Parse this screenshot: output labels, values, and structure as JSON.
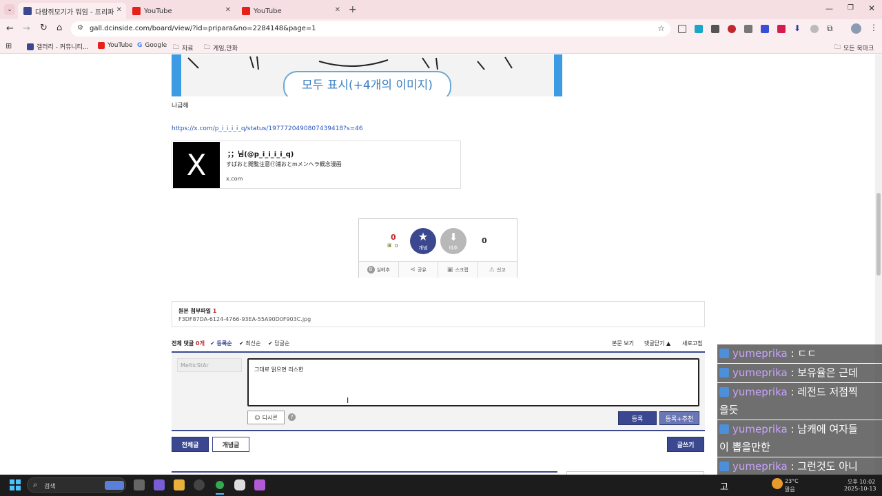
{
  "browser": {
    "tabs": [
      {
        "title": "다람쥐모기가 뭐임 - 프리파라",
        "active": true
      },
      {
        "title": "YouTube",
        "active": false
      },
      {
        "title": "YouTube",
        "active": false
      }
    ],
    "url": "gall.dcinside.com/board/view/?id=pripara&no=2284148&page=1",
    "bookmarks": [
      "갤러리 - 커뮤니티...",
      "YouTube",
      "Google",
      "자료",
      "게임,만화"
    ],
    "bookmarks_right": "모든 북마크"
  },
  "post": {
    "image_button": "모두 표시(+4개의 이미지)",
    "text_line": "나급해",
    "link": "https://x.com/p_i_i_i_i_q/status/1977720490807439418?s=46",
    "embed": {
      "name": "；；님(@p_i_i_i_i_q)",
      "desc": "すばおと閲覧注意⑰浦おとmメンヘラ概念漫画",
      "domain": "x.com"
    }
  },
  "vote": {
    "up_count": "0",
    "fixed_count": "0",
    "up_label": "개념",
    "down_label": "비추",
    "down_count": "0",
    "actions": [
      "실베추",
      "공유",
      "스크랩",
      "신고"
    ]
  },
  "attach": {
    "title": "원본 첨부파일",
    "count": "1",
    "file": "F3DF87DA-6124-4766-93EA-55A90D0F903C.jpg"
  },
  "comments": {
    "total_label": "전체 댓글",
    "total_count": "0개",
    "sort": [
      "등록순",
      "최신순",
      "답글순"
    ],
    "right_links": [
      "본문 보기",
      "댓글닫기 ▲",
      "새로고침"
    ],
    "nickname": "MelticStAr",
    "draft": "그대로 읽으면 리스한",
    "dccon": "디시콘",
    "submit": "등록",
    "submit_recommend": "등록+추천"
  },
  "board_buttons": {
    "all": "전체글",
    "concept": "개념글",
    "write": "글쓰기"
  },
  "chat": [
    {
      "name": "yumeprika",
      "msg": " : ㄷㄷ"
    },
    {
      "name": "yumeprika",
      "msg": " : 보유율은 근데"
    },
    {
      "name": "yumeprika",
      "msg": " : 레전드 저점찍",
      "cont": "을듯"
    },
    {
      "name": "yumeprika",
      "msg": " : 남캐에 여자들",
      "cont": "이 뽑을만한"
    },
    {
      "name": "yumeprika",
      "msg": " : 그런것도 아니"
    }
  ],
  "taskbar": {
    "search": "검색",
    "ime": "고",
    "weather_temp": "23°C",
    "weather_desc": "맑음",
    "time": "오후 10:02",
    "date": "2025-10-13"
  }
}
